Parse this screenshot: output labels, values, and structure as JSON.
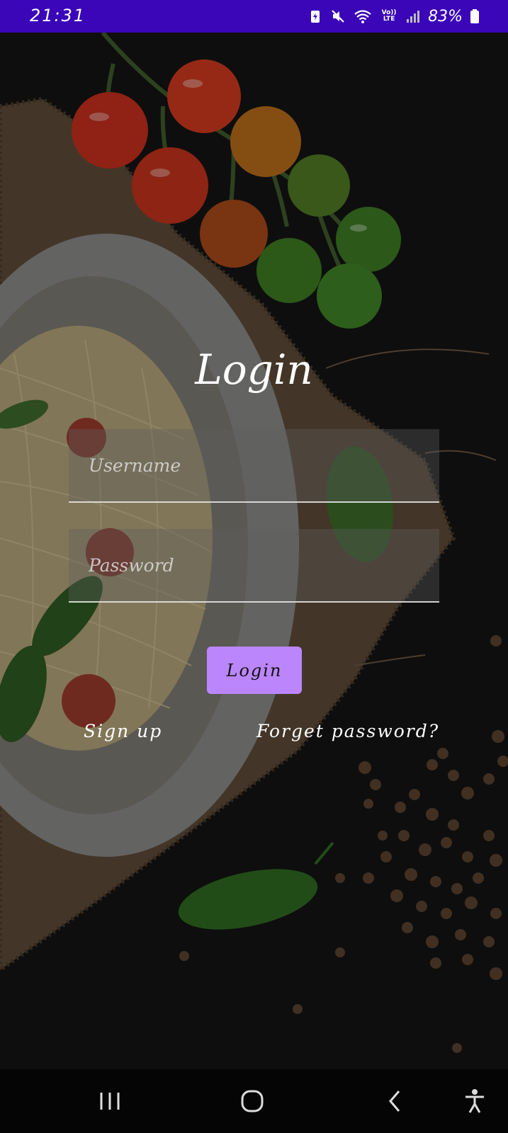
{
  "status_bar": {
    "time": "21:31",
    "battery_percent": "83%",
    "network_label": "Vo)) LTE",
    "icons": [
      "battery-saver-icon",
      "mute-icon",
      "wifi-icon",
      "volte-icon",
      "signal-icon",
      "battery-icon"
    ]
  },
  "login": {
    "title": "Login",
    "username_placeholder": "Username",
    "username_value": "",
    "password_placeholder": "Password",
    "password_value": "",
    "button_label": "Login",
    "signup_label": "Sign up",
    "forget_label": "Forget password?"
  },
  "theme": {
    "status_bar_color": "#3a06b8",
    "button_color": "#bb86fc",
    "background_color": "#141414"
  },
  "nav_bar": {
    "icons": [
      "recent-apps-icon",
      "home-icon",
      "back-icon",
      "accessibility-icon"
    ]
  }
}
